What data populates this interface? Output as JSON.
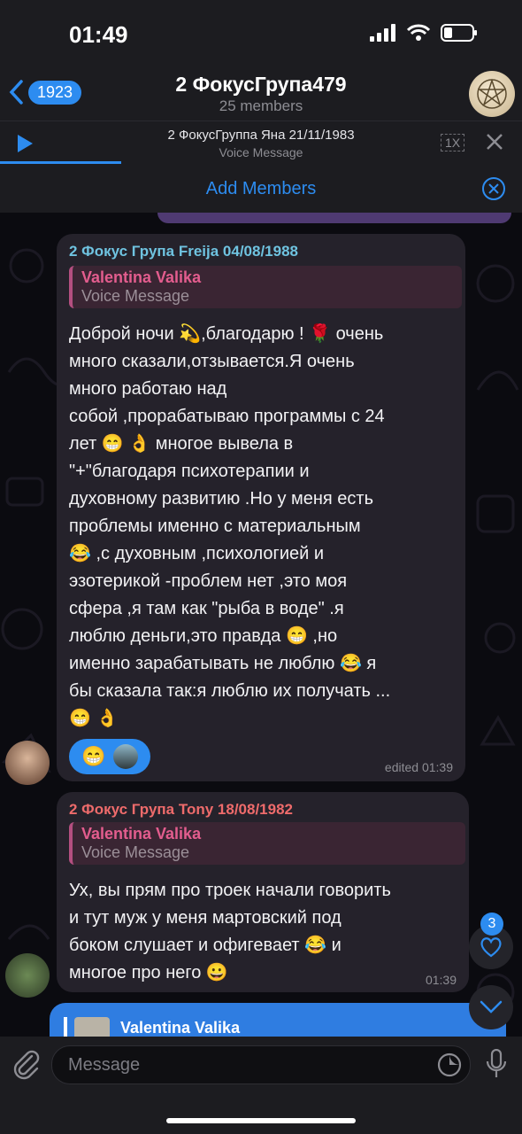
{
  "status_bar": {
    "time": "01:49"
  },
  "header": {
    "back_count": "1923",
    "title": "2 ФокусГрупа479",
    "subtitle": "25 members"
  },
  "player": {
    "title": "2 ФокусГруппа Яна 21/11/1983",
    "subtitle": "Voice Message",
    "speed": "1X"
  },
  "add_members": {
    "label": "Add Members"
  },
  "messages": [
    {
      "sender": "2 Фокус Група Freija 04/08/1988",
      "sender_color": "#6fc3e0",
      "reply_name": "Valentina Valika",
      "reply_text": "Voice Message",
      "lines": [
        "Доброй ночи 💫,благодарю ! 🌹 очень",
        "много сказали,отзывается.Я очень",
        "много работаю над",
        "собой ,прорабатываю программы с 24",
        "лет 😁 👌 многое вывела в",
        "\"+\"благодаря психотерапии и",
        "духовному развитию .Но у меня есть",
        "проблемы именно с материальным",
        "😂 ,с духовным ,психологией и",
        "эзотерикой -проблем нет ,это моя",
        "сфера ,я там как \"рыба в воде\" .я",
        "люблю деньги,это правда 😁 ,но",
        "именно зарабатывать не люблю 😂 я",
        "бы сказала так:я люблю их получать ...",
        "😁 👌"
      ],
      "reaction": "😁",
      "meta": "edited 01:39"
    },
    {
      "sender": "2 Фокус Група Tony 18/08/1982",
      "sender_color": "#ee6b6b",
      "reply_name": "Valentina Valika",
      "reply_text": "Voice Message",
      "lines": [
        "Ух, вы прям про троек начали говорить",
        "и тут муж у меня мартовский под",
        "боком слушает и офигевает 😂 и",
        "многое про него 😀"
      ],
      "meta": "01:39"
    }
  ],
  "partial_message": {
    "reply_name": "Valentina Valika"
  },
  "unread_reactions": "3",
  "composer": {
    "placeholder": "Message"
  }
}
